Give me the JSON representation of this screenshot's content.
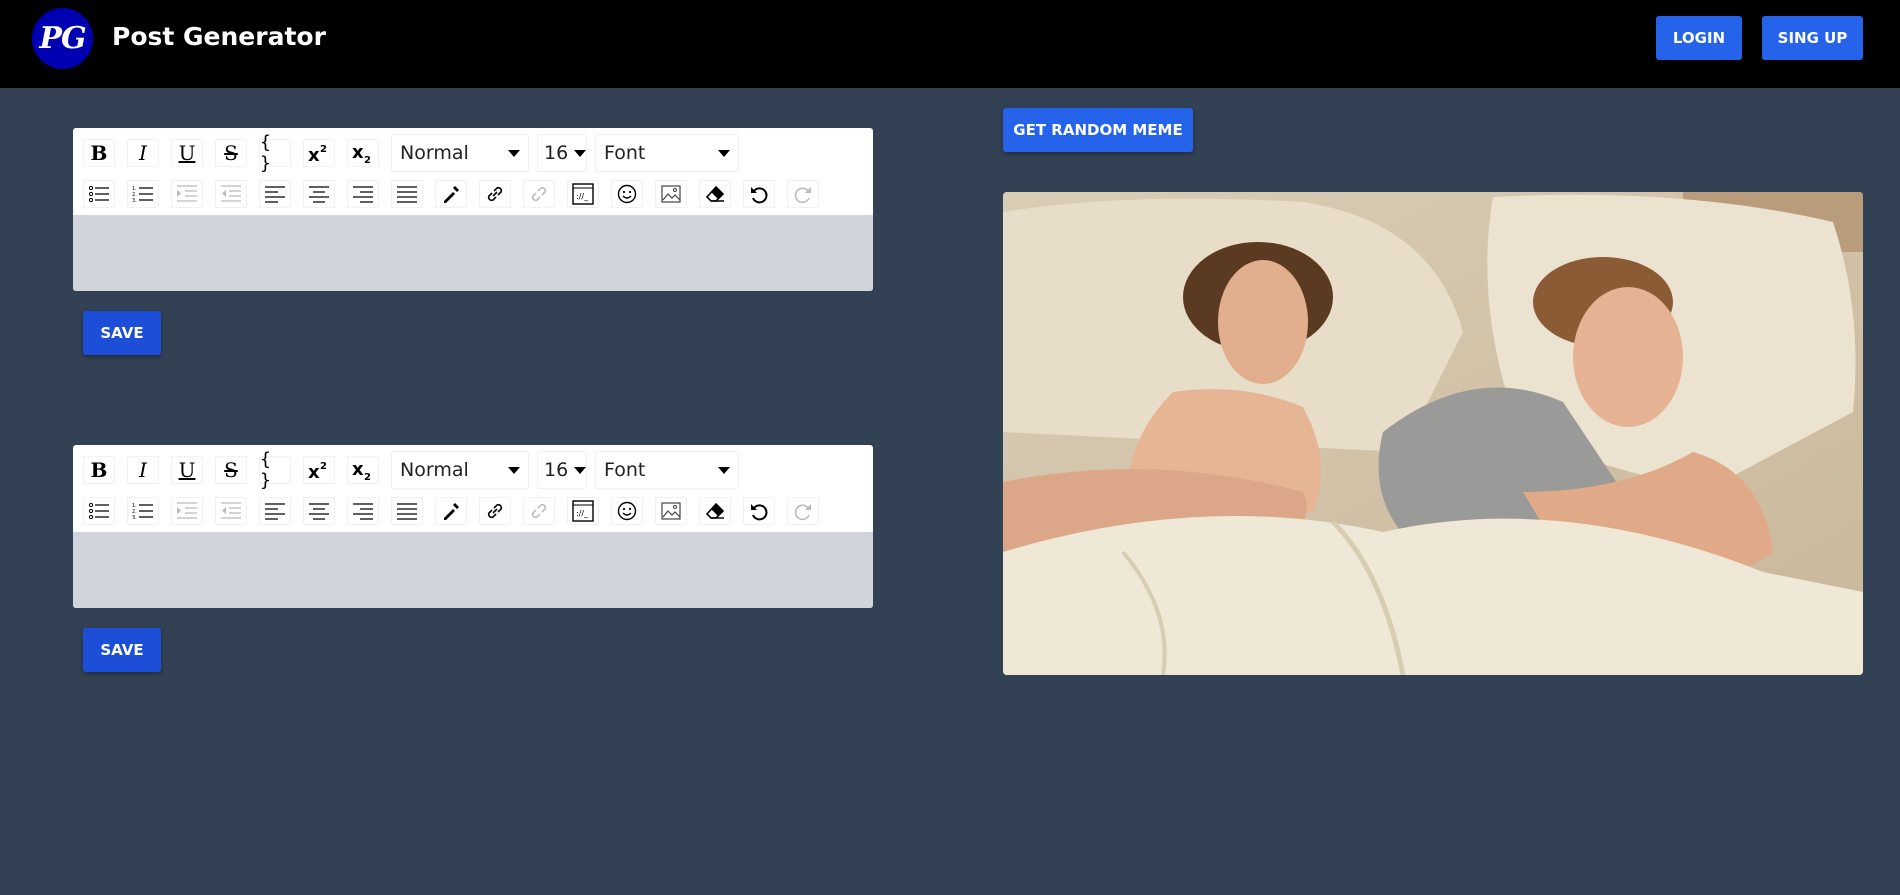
{
  "header": {
    "logo_text": "PG",
    "app_title": "Post Generator",
    "login_label": "LOGIN",
    "signup_label": "SING UP",
    "bg_color": "#000000",
    "logo_color": "#0000b3"
  },
  "editors": [
    {
      "block_type": "Normal",
      "font_size": "16",
      "font_family": "Font",
      "save_label": "SAVE"
    },
    {
      "block_type": "Normal",
      "font_size": "16",
      "font_family": "Font",
      "save_label": "SAVE"
    }
  ],
  "toolbar": {
    "row1_icons": [
      "bold-icon",
      "italic-icon",
      "underline-icon",
      "strikethrough-icon",
      "code-icon",
      "superscript-icon",
      "subscript-icon"
    ],
    "row2_icons": [
      "unordered-list-icon",
      "ordered-list-icon",
      "indent-icon",
      "outdent-icon",
      "align-left-icon",
      "align-center-icon",
      "align-right-icon",
      "align-justify-icon",
      "color-picker-icon",
      "link-icon",
      "unlink-icon",
      "embed-icon",
      "emoji-icon",
      "image-icon",
      "eraser-icon",
      "undo-icon",
      "redo-icon"
    ],
    "bold_glyph": "B",
    "italic_glyph": "I",
    "underline_glyph": "U",
    "strike_glyph": "S",
    "code_glyph": "{ }"
  },
  "meme": {
    "button_label": "GET RANDOM MEME",
    "image_description_icon": "meme-image"
  },
  "colors": {
    "page_bg": "#334155",
    "primary": "#2563eb",
    "editor_body": "#d1d5db"
  }
}
